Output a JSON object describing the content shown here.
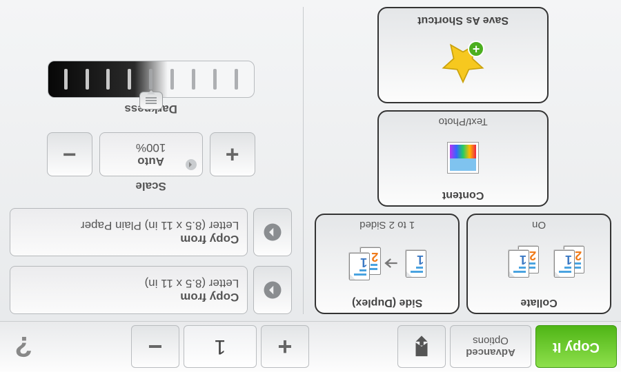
{
  "topbar": {
    "copy_it": "Copy It",
    "advanced_l1": "Advanced",
    "advanced_l2": "Options",
    "count": "1"
  },
  "left": {
    "collate": {
      "label": "Collate",
      "value": "On"
    },
    "duplex": {
      "label": "Side (Duplex)",
      "value": "1 to 2 Sided"
    },
    "content": {
      "label": "Content",
      "value": "Text/Photo"
    },
    "shortcut": {
      "label": "Save As Shortcut"
    }
  },
  "right": {
    "copy_from": {
      "title": "Copy from",
      "value": "Letter (8.5 x 11 in)"
    },
    "copy_to": {
      "title": "Copy from",
      "value": "Letter (8.5 x 11 in) Plain Paper"
    },
    "scale": {
      "label": "Scale",
      "mode": "Auto",
      "value": "100%"
    },
    "darkness": {
      "label": "Darkness"
    }
  }
}
